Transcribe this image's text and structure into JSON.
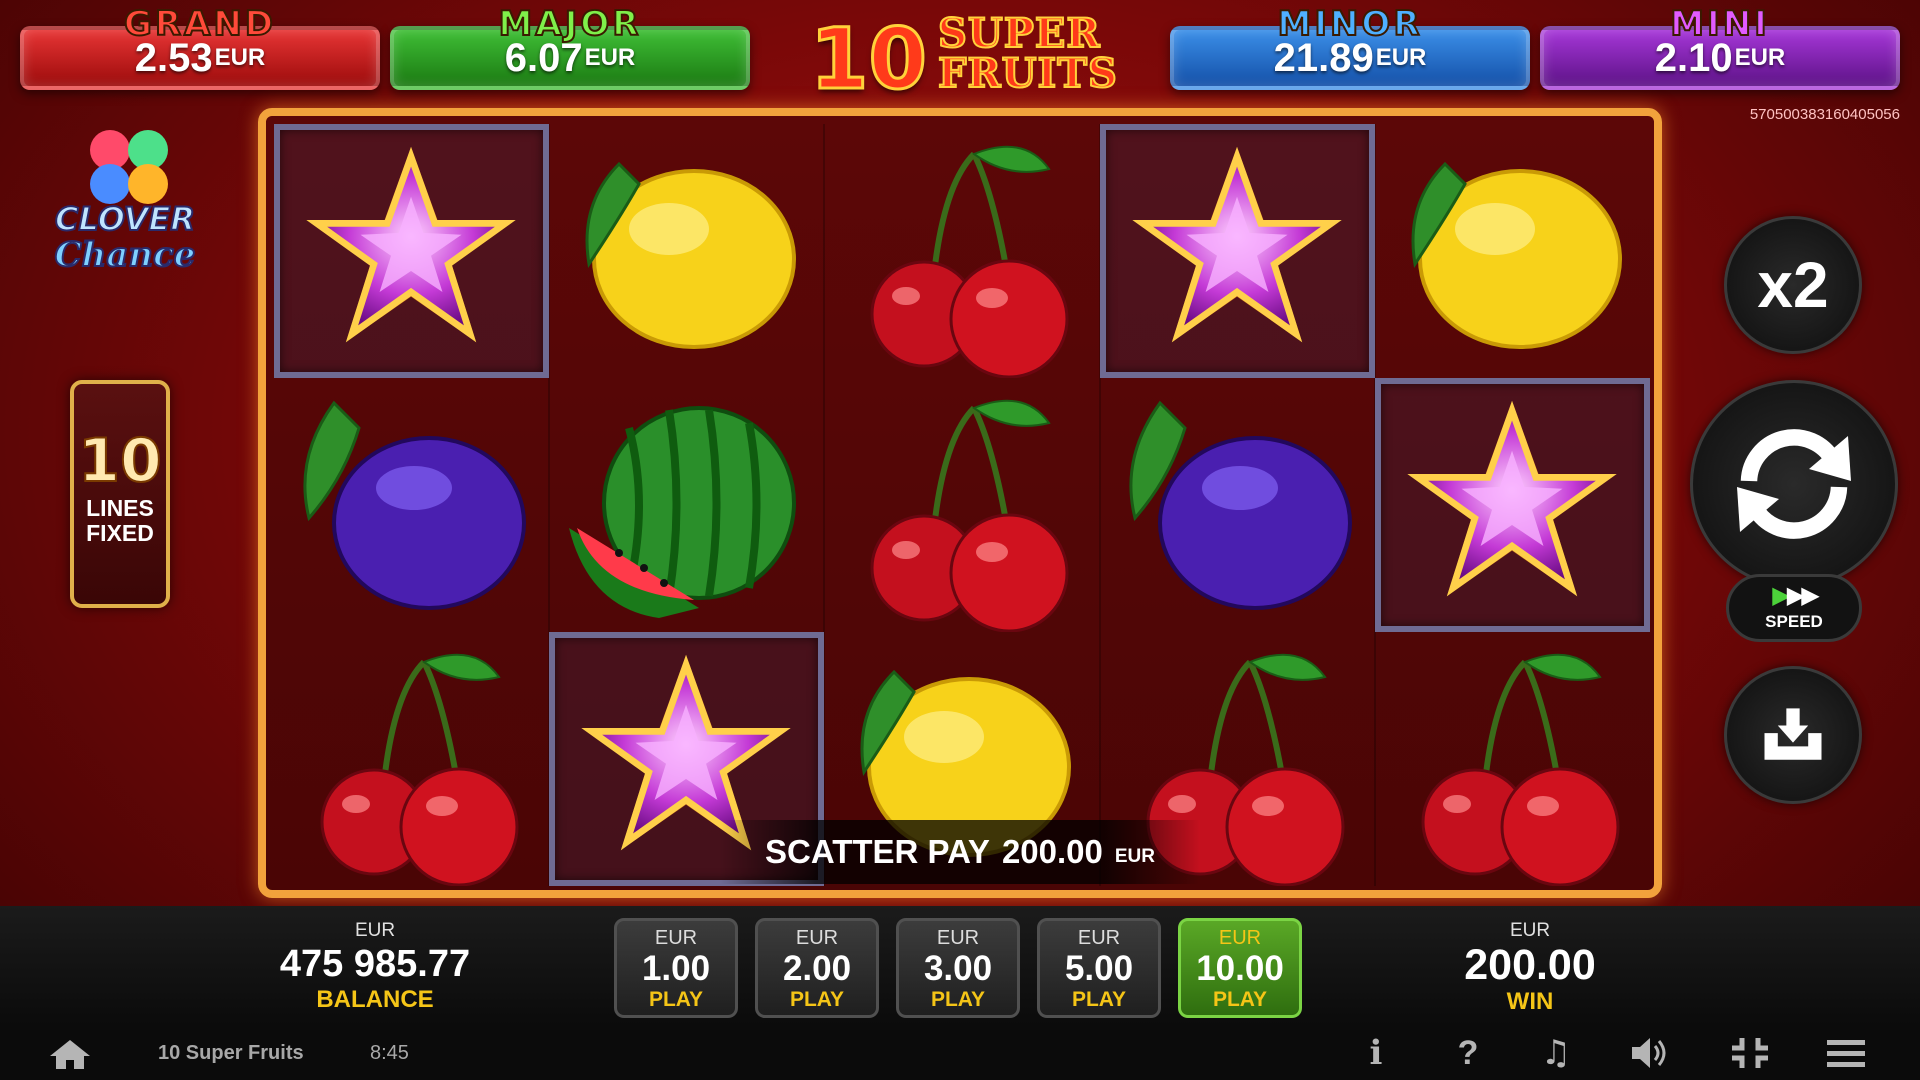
{
  "jackpots": {
    "grand": {
      "title": "GRAND",
      "value": "2.53",
      "currency": "EUR"
    },
    "major": {
      "title": "MAJOR",
      "value": "6.07",
      "currency": "EUR"
    },
    "minor": {
      "title": "MINOR",
      "value": "21.89",
      "currency": "EUR"
    },
    "mini": {
      "title": "MINI",
      "value": "2.10",
      "currency": "EUR"
    }
  },
  "logo": {
    "number": "10",
    "text": "SUPER FRUITS"
  },
  "game_id": "570500383160405056",
  "clover": {
    "line1": "CLOVER",
    "line2": "Chance"
  },
  "lines": {
    "number": "10",
    "label1": "LINES",
    "label2": "FIXED"
  },
  "reels": [
    [
      "star",
      "plum",
      "cherry"
    ],
    [
      "lemon",
      "watermelon",
      "star"
    ],
    [
      "cherry",
      "cherry",
      "lemon"
    ],
    [
      "star",
      "plum",
      "cherry"
    ],
    [
      "lemon",
      "star",
      "cherry"
    ]
  ],
  "highlighted_symbol": "star",
  "scatter": {
    "label": "SCATTER PAY",
    "value": "200.00",
    "currency": "EUR"
  },
  "controls": {
    "multiplier": "x2",
    "spin_icon": "refresh-icon",
    "speed_label": "SPEED",
    "autoplay_icon": "download-tray-icon"
  },
  "balance": {
    "currency": "EUR",
    "value": "475 985.77",
    "label": "BALANCE"
  },
  "bets": [
    {
      "currency": "EUR",
      "value": "1.00",
      "label": "PLAY",
      "active": false
    },
    {
      "currency": "EUR",
      "value": "2.00",
      "label": "PLAY",
      "active": false
    },
    {
      "currency": "EUR",
      "value": "3.00",
      "label": "PLAY",
      "active": false
    },
    {
      "currency": "EUR",
      "value": "5.00",
      "label": "PLAY",
      "active": false
    },
    {
      "currency": "EUR",
      "value": "10.00",
      "label": "PLAY",
      "active": true
    }
  ],
  "win": {
    "currency": "EUR",
    "value": "200.00",
    "label": "WIN"
  },
  "status": {
    "title": "10 Super Fruits",
    "time": "8:45",
    "icons": [
      "home-icon",
      "info-icon",
      "help-icon",
      "music-icon",
      "volume-icon",
      "fullscreen-exit-icon",
      "menu-icon"
    ]
  },
  "colors": {
    "frame": "#f2a23c",
    "accent_yellow": "#f5c517",
    "active_bet": "#5aa826"
  }
}
